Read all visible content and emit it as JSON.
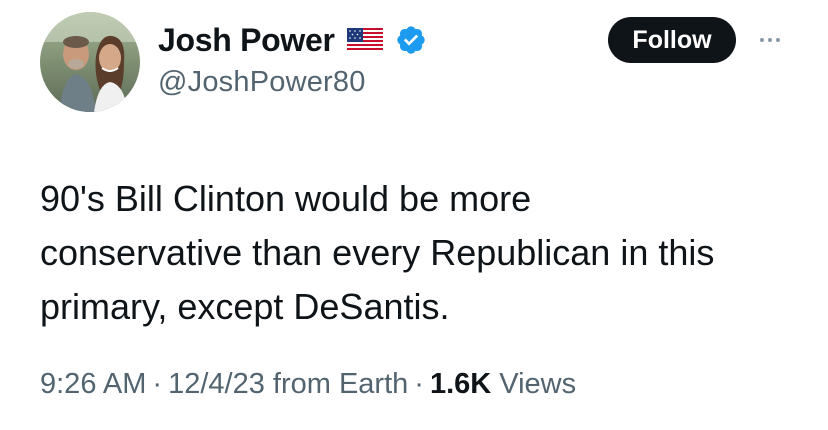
{
  "author": {
    "display_name": "Josh Power",
    "handle": "@JoshPower80",
    "flag": "us-flag-emoji",
    "verified_icon": "verified-badge-icon",
    "verified_color": "#1d9bf0"
  },
  "actions": {
    "follow_label": "Follow",
    "more_icon": "more-options-icon"
  },
  "tweet": {
    "text": "90's Bill Clinton would be more\nconservative than every Republican in this\nprimary, except DeSantis."
  },
  "meta": {
    "time": "9:26 AM",
    "date": "12/4/23",
    "source": "from Earth",
    "separator": "·",
    "views_count": "1.6K",
    "views_label": "Views"
  }
}
